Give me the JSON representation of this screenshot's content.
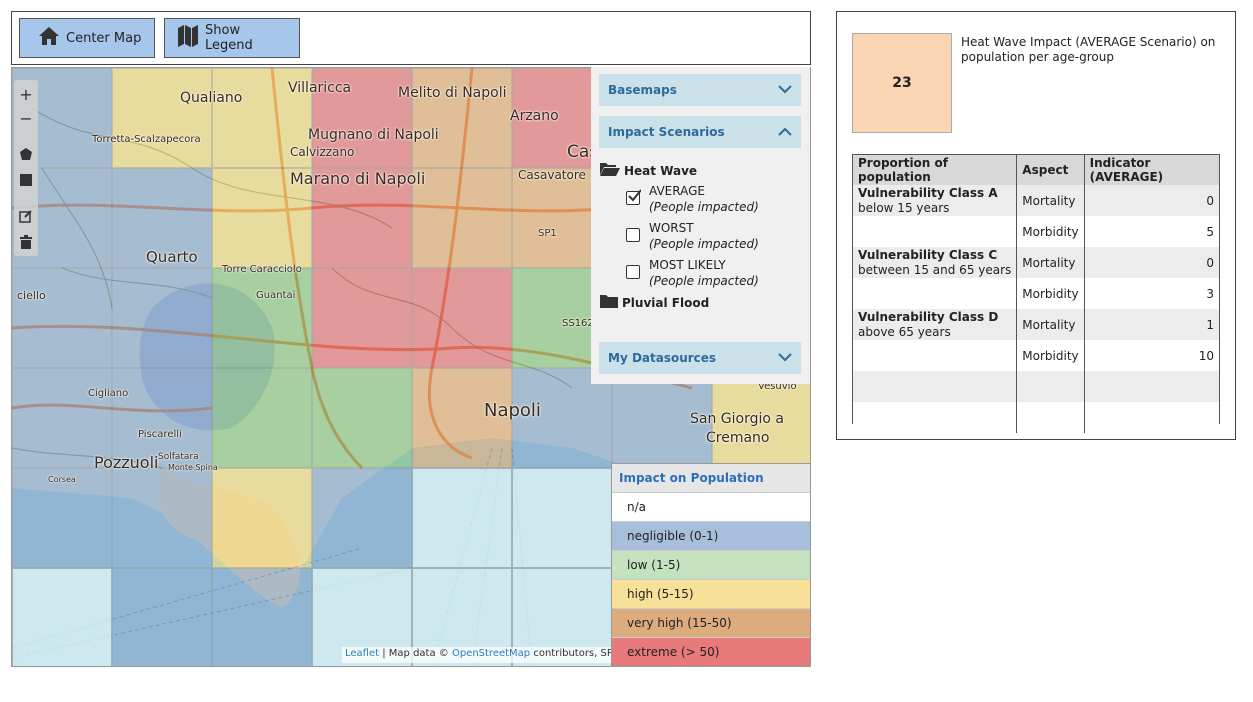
{
  "toolbar": {
    "center_label": "Center Map",
    "legend_label": "Show Legend"
  },
  "map": {
    "place_labels": [
      "Qualiano",
      "Villaricca",
      "Melito di Napoli",
      "Arzano",
      "Torretta-Scalzapecora",
      "Mugnano di Napoli",
      "Calvizzano",
      "Cas",
      "Marano di Napoli",
      "Casavatore",
      "SP1",
      "Quarto",
      "Torre Caracciolo",
      "Guantai",
      "SS162",
      "ciello",
      "Napoli",
      "Vesuvio",
      "Cigliano",
      "San Giorgio a",
      "Cremano",
      "Piscarelli",
      "Pozzuoli",
      "Solfatara",
      "Corsea",
      "Monte Spina"
    ],
    "attribution": {
      "leaflet": "Leaflet",
      "sep1": " | Map data © ",
      "osm": "OpenStreetMap",
      "rest": " contributors, SRTM |"
    },
    "cells": [
      [
        "negligible",
        "high",
        "high",
        "extreme",
        "very high",
        "extreme"
      ],
      [
        "negligible",
        "negligible",
        "high",
        "extreme",
        "very high",
        "very high"
      ],
      [
        "negligible",
        "negligible",
        "low",
        "extreme",
        "extreme",
        "low"
      ],
      [
        "negligible",
        "negligible",
        "low",
        "low",
        "very high",
        "negligible",
        "negligible",
        "high"
      ],
      [
        "negligible",
        "negligible",
        "high",
        "negligible",
        "na",
        "na"
      ],
      [
        "na",
        "negligible",
        "negligible",
        "na",
        "na",
        "na"
      ]
    ]
  },
  "controls": {
    "zoom_in": "+",
    "zoom_out": "−"
  },
  "layers": {
    "basemaps": "Basemaps",
    "impact_scenarios": "Impact Scenarios",
    "heat_wave": "Heat Wave",
    "scenarios": [
      {
        "name": "AVERAGE",
        "sub": "(People impacted)",
        "checked": true
      },
      {
        "name": "WORST",
        "sub": "(People impacted)",
        "checked": false
      },
      {
        "name": "MOST LIKELY",
        "sub": "(People impacted)",
        "checked": false
      }
    ],
    "pluvial_flood": "Pluvial Flood",
    "my_datasources": "My Datasources"
  },
  "legend": {
    "title": "Impact on Population",
    "items": [
      {
        "label": "n/a",
        "color": "#ffffff"
      },
      {
        "label": "negligible (0-1)",
        "color": "#a8bfdb"
      },
      {
        "label": "low (1-5)",
        "color": "#c5e2bf"
      },
      {
        "label": "high (5-15)",
        "color": "#f7e199"
      },
      {
        "label": "very high (15-50)",
        "color": "#dcab7e"
      },
      {
        "label": "extreme (> 50)",
        "color": "#e97a7c"
      }
    ]
  },
  "colors": {
    "negligible": "#7d9ec8",
    "low": "#7fbf6f",
    "high": "#f3d46a",
    "very high": "#e4a060",
    "extreme": "#e85d62",
    "na": "#d4ecf2"
  },
  "side": {
    "badge_value": "23",
    "title": "Heat Wave  Impact (AVERAGE Scenario) on population per age-group",
    "headers": [
      "Proportion of population",
      "Aspect",
      "Indicator (AVERAGE)"
    ],
    "rows": [
      {
        "class": "Vulnerability Class A",
        "desc": "below 15 years",
        "aspect": "Mortality",
        "value": "0"
      },
      {
        "class": "",
        "desc": "",
        "aspect": "Morbidity",
        "value": "5"
      },
      {
        "class": "Vulnerability Class C",
        "desc": "between 15 and 65 years",
        "aspect": "Mortality",
        "value": "0"
      },
      {
        "class": "",
        "desc": "",
        "aspect": "Morbidity",
        "value": "3"
      },
      {
        "class": "Vulnerability Class D",
        "desc": "above 65 years",
        "aspect": "Mortality",
        "value": "1"
      },
      {
        "class": "",
        "desc": "",
        "aspect": "Morbidity",
        "value": "10"
      }
    ]
  }
}
